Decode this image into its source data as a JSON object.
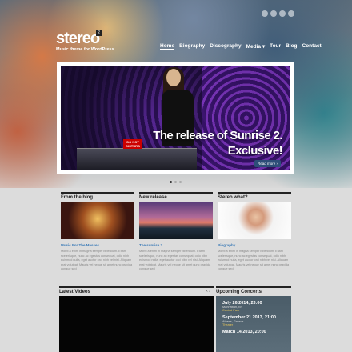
{
  "header": {
    "logo": "stereo",
    "logo_badge": "2",
    "tagline": "Music theme for WordPress"
  },
  "nav": [
    {
      "label": "Home",
      "active": true
    },
    {
      "label": "Biography"
    },
    {
      "label": "Discography"
    },
    {
      "label": "Media ▾"
    },
    {
      "label": "Tour"
    },
    {
      "label": "Blog"
    },
    {
      "label": "Contact"
    }
  ],
  "social_icons": [
    "rss-icon",
    "twitter-icon",
    "facebook-icon",
    "lastfm-icon"
  ],
  "slider": {
    "headline_line1": "The release of Sunrise 2.",
    "headline_line2": "Exclusive!",
    "read_more": "Read more ›",
    "sticker": "DO NOT DISTURB",
    "slides": 3,
    "active_slide": 1
  },
  "columns": [
    {
      "heading": "From the blog",
      "link": "Music For The Masses",
      "text": "Morbi a enim in magna semper bibendum. Etiam scelerisque, nunc ac egestas consequat, odio nibh euismod nulla, eget auctor orci nibh vel nisi. Aliquam erat volutpat. Mauris vel neque sit amet nunc gravida congue sed"
    },
    {
      "heading": "New release",
      "link": "The sunrise 2",
      "text": "Morbi a enim in magna semper bibendum. Etiam scelerisque, nunc ac egestas consequat, odio nibh euismod nulla, eget auctor orci nibh vel nisi. Aliquam erat volutpat. Mauris vel neque sit amet nunc gravida congue sed"
    },
    {
      "heading": "Stereo what?",
      "link": "Biography",
      "text": "Morbi a enim in magna semper bibendum. Etiam scelerisque, nunc ac egestas consequat, odio nibh euismod nulla, eget auctor orci nibh vel nisi. Aliquam erat volutpat. Mauris vel neque sit amet nunc gravida congue sed"
    }
  ],
  "videos": {
    "heading": "Latest Videos",
    "prev": "‹",
    "next": "›"
  },
  "concerts": {
    "heading": "Upcoming Concerts",
    "items": [
      {
        "date": "July 26 2014, 23:00",
        "place": "Manhattan, NY",
        "venue": "Central Park"
      },
      {
        "date": "September 21 2013, 21:00",
        "place": "Athens, Greece",
        "venue": "Theater"
      },
      {
        "date": "March 14 2013, 20:00",
        "place": "",
        "venue": ""
      }
    ]
  }
}
